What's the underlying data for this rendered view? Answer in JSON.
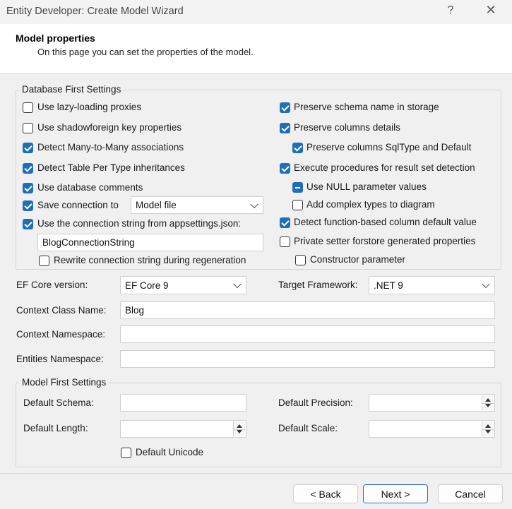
{
  "window": {
    "title": "Entity Developer: Create Model Wizard",
    "help_glyph": "?",
    "close_glyph": "✕"
  },
  "header": {
    "title": "Model properties",
    "subtitle": "On this page you can set the properties of the model."
  },
  "db_first": {
    "group_label": "Database First Settings",
    "lazy_loading": "Use lazy-loading proxies",
    "shadow_fk": "Use shadowforeign key properties",
    "many_to_many": "Detect Many-to-Many associations",
    "tpt": "Detect Table Per Type inheritances",
    "db_comments": "Use database comments",
    "save_connection": "Save connection to",
    "save_connection_value": "Model file",
    "use_appsettings": "Use the connection string from appsettings.json:",
    "connection_string_name": "BlogConnectionString",
    "rewrite_connection": "Rewrite connection string during regeneration",
    "preserve_schema": "Preserve schema name in storage",
    "preserve_columns": "Preserve columns details",
    "preserve_sqltype": "Preserve columns SqlType and Default",
    "execute_procedures": "Execute procedures for result set detection",
    "use_null": "Use NULL parameter values",
    "add_complex": "Add complex types to diagram",
    "detect_function_default": "Detect function-based column default value",
    "private_setter": "Private setter forstore generated properties",
    "constructor_param": "Constructor parameter"
  },
  "general": {
    "ef_core_label": "EF Core version:",
    "ef_core_value": "EF Core 9",
    "target_framework_label": "Target Framework:",
    "target_framework_value": ".NET 9",
    "context_class_label": "Context Class Name:",
    "context_class_value": "Blog",
    "context_namespace_label": "Context Namespace:",
    "context_namespace_value": "",
    "entities_namespace_label": "Entities Namespace:",
    "entities_namespace_value": ""
  },
  "model_first": {
    "group_label": "Model First Settings",
    "default_schema_label": "Default Schema:",
    "default_schema_value": "",
    "default_length_label": "Default Length:",
    "default_length_value": "",
    "default_precision_label": "Default Precision:",
    "default_precision_value": "",
    "default_scale_label": "Default Scale:",
    "default_scale_value": "",
    "default_unicode": "Default Unicode"
  },
  "footer": {
    "back": "< Back",
    "next": "Next >",
    "cancel": "Cancel"
  },
  "colors": {
    "accent": "#1f6fb8",
    "primary_border": "#2a6fc0"
  }
}
